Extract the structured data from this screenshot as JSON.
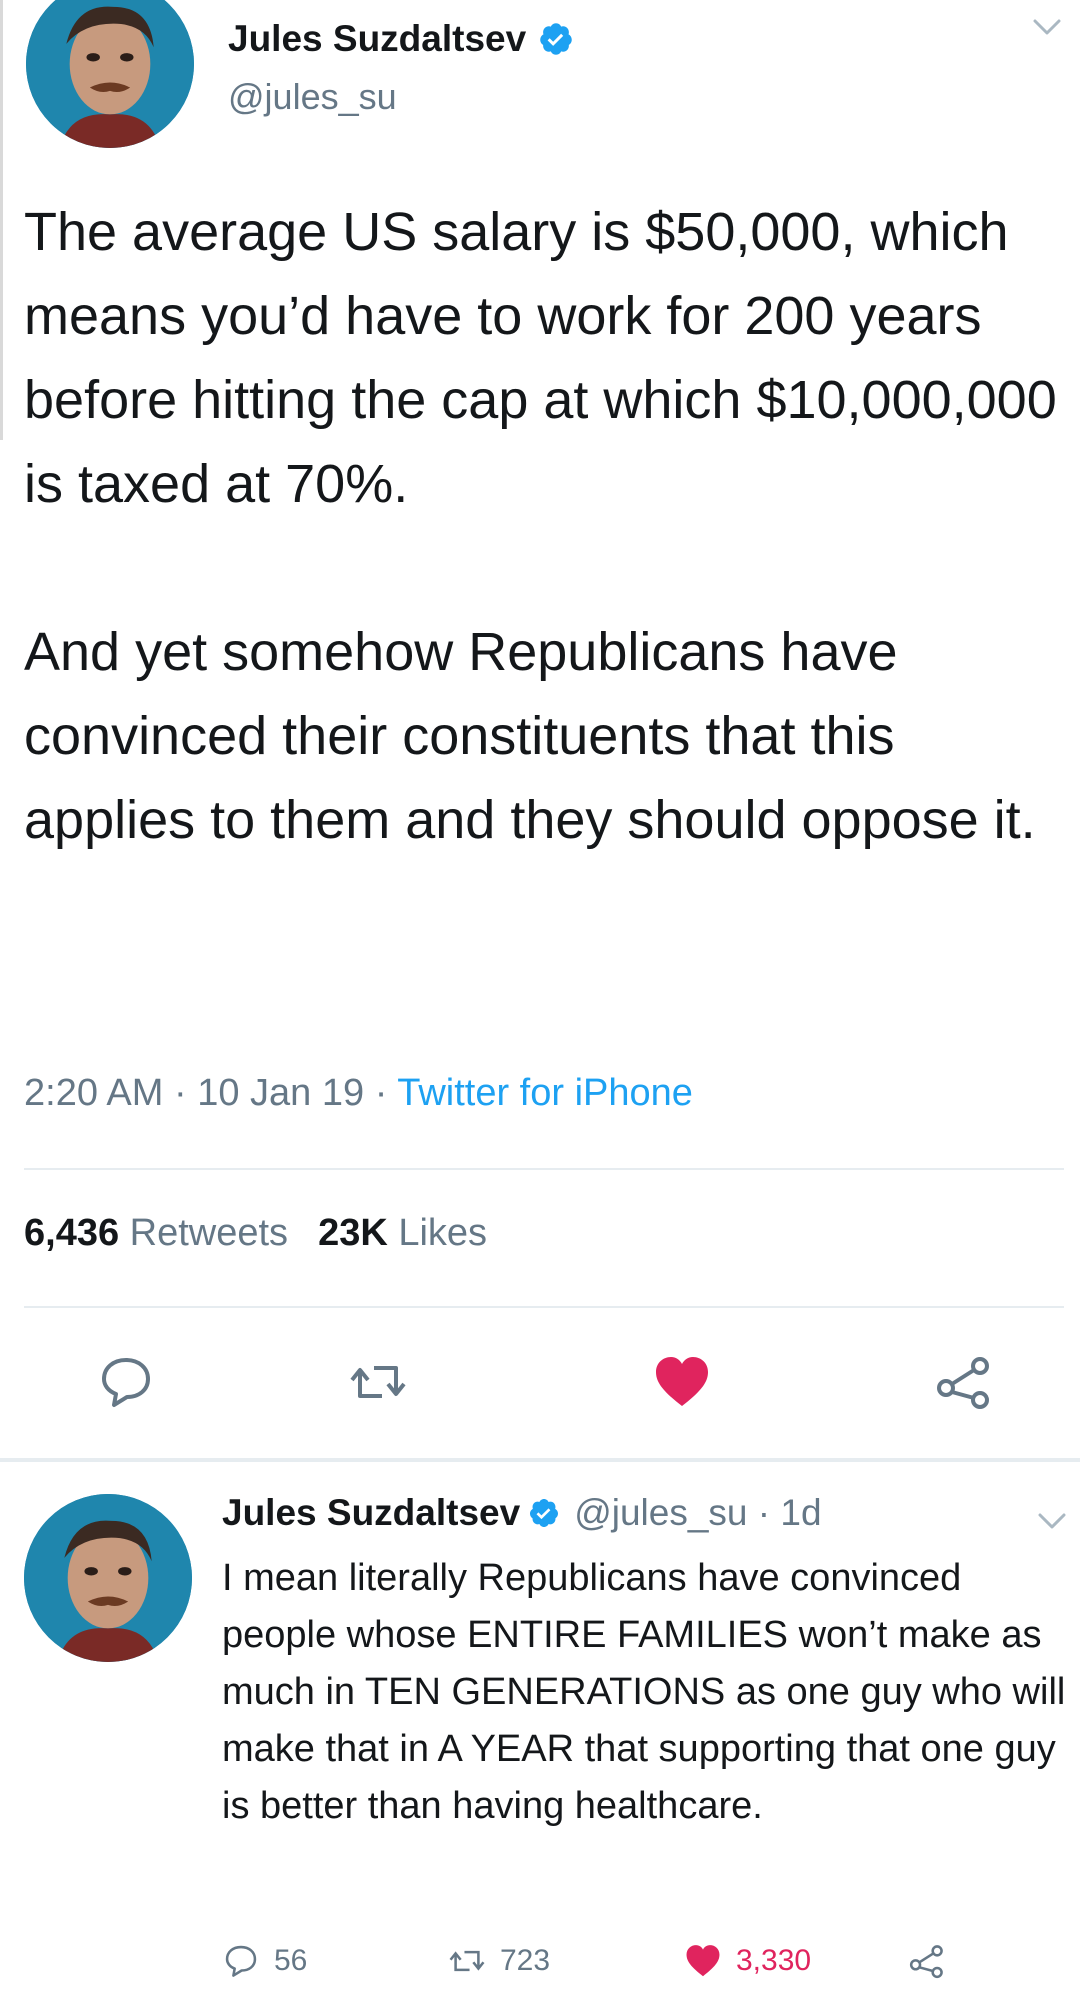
{
  "tweet": {
    "author_name": "Jules Suzdaltsev",
    "handle": "@jules_su",
    "paragraphs": [
      "The average US salary is $50,000, which means you’d have to work for 200 years before hitting the cap at which $10,000,000 is taxed at 70%.",
      "And yet somehow Republicans have convinced their constituents that this applies to them and they should oppose it."
    ],
    "time": "2:20 AM",
    "date": "10 Jan 19",
    "separator": "·",
    "client": "Twitter for iPhone",
    "retweets_count": "6,436",
    "retweets_label": "Retweets",
    "likes_count": "23K",
    "likes_label": "Likes",
    "liked": true
  },
  "reply": {
    "author_name": "Jules Suzdaltsev",
    "handle": "@jules_su",
    "age": "1d",
    "text": "I mean literally Republicans have convinced people whose ENTIRE FAMILIES won’t make as much in TEN GENERATIONS as one guy who will make that in A YEAR that supporting that one guy is better than having healthcare.",
    "reply_count": "56",
    "retweet_count": "723",
    "like_count": "3,330"
  },
  "colors": {
    "text": "#14171a",
    "secondary": "#657786",
    "link": "#1da1f2",
    "like": "#e0245e",
    "verified": "#1da1f2"
  },
  "icons": [
    "verified-badge-icon",
    "chevron-down-icon",
    "reply-icon",
    "retweet-icon",
    "heart-icon",
    "share-icon"
  ]
}
